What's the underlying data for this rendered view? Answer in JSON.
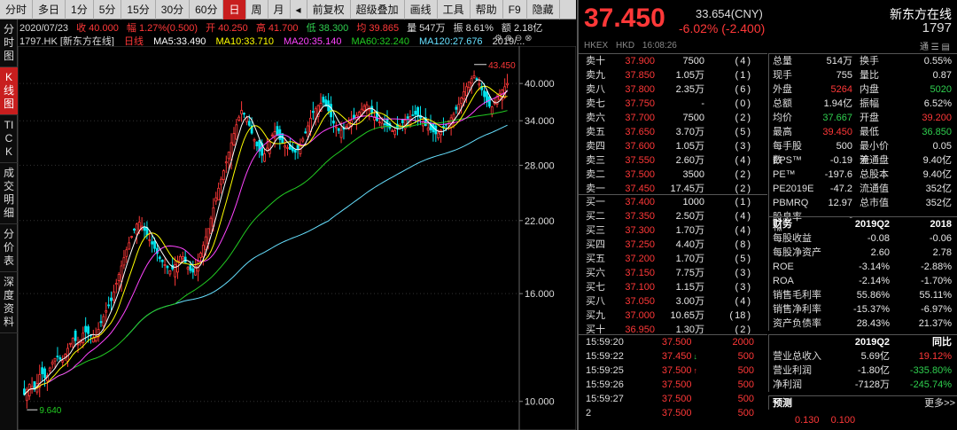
{
  "toolbar": [
    "分时",
    "多日",
    "1分",
    "5分",
    "15分",
    "30分",
    "60分",
    "日",
    "周",
    "月",
    "◂",
    "前复权",
    "超级叠加",
    "画线",
    "工具",
    "帮助",
    "F9",
    "隐藏"
  ],
  "toolbar_active": "日",
  "vtabs": [
    {
      "label": "分时图",
      "active": false
    },
    {
      "label": "K线图",
      "active": true
    },
    {
      "label": "TICK",
      "active": false
    },
    {
      "label": "成交明细",
      "active": false
    },
    {
      "label": "分价表",
      "active": false
    },
    {
      "label": "深度资料",
      "active": false
    }
  ],
  "info1": {
    "date": "2020/07/23",
    "open_close": "收 40.000",
    "amp": "幅 1.27%(0.500)",
    "open": "开 40.250",
    "high": "高 41.700",
    "low": "低 38.300",
    "high2": "均 39.865",
    "vol": "量 547万",
    "swing": "振 8.61%",
    "amount": "额 2.18亿"
  },
  "info2": {
    "code": "1797.HK [新东方在线]",
    "period": "日线",
    "ma5": "MA5:33.490",
    "ma10": "MA10:33.710",
    "ma20": "MA20:35.140",
    "ma60": "MA60:32.240",
    "ma120": "MA120:27.676",
    "date_short": "2019/..."
  },
  "colors": {
    "ma5": "#ffffff",
    "ma10": "#ffff00",
    "ma20": "#ff44ff",
    "ma60": "#22cc22",
    "ma120": "#66e0ff",
    "up": "#ff3838",
    "down": "#00e5ee"
  },
  "chart_data": {
    "type": "candlestick",
    "y_ticks": [
      "40.000",
      "34.000",
      "28.000",
      "22.000",
      "16.000",
      "10.000"
    ],
    "y_log_range": [
      9.0,
      46.0
    ],
    "max_label": "43.450",
    "min_label": "9.640",
    "close_path": [
      10.3,
      10.8,
      10.5,
      11.4,
      11.0,
      11.8,
      12.2,
      11.9,
      12.6,
      13.2,
      12.8,
      13.6,
      13.4,
      13.1,
      14.0,
      14.8,
      15.5,
      16.8,
      18.2,
      19.6,
      20.8,
      22.0,
      21.2,
      20.3,
      19.5,
      18.6,
      18.1,
      17.6,
      18.3,
      19.0,
      18.0,
      17.5,
      18.4,
      19.8,
      21.4,
      23.6,
      25.8,
      27.9,
      30.5,
      33.2,
      35.6,
      34.4,
      32.0,
      30.2,
      29.0,
      30.6,
      32.6,
      31.4,
      30.5,
      30.0,
      29.6,
      30.8,
      32.6,
      35.0,
      36.2,
      37.0,
      35.6,
      33.6,
      32.5,
      32.8,
      33.8,
      34.6,
      35.6,
      36.6,
      35.2,
      34.0,
      33.6,
      33.2,
      32.4,
      33.0,
      34.0,
      34.6,
      35.0,
      34.4,
      33.2,
      32.6,
      32.0,
      32.8,
      33.8,
      34.8,
      36.4,
      38.6,
      40.4,
      41.5,
      39.6,
      37.2,
      35.8,
      37.6,
      38.8,
      40.0
    ]
  },
  "quote": {
    "price": "37.450",
    "ref": "33.654(CNY)",
    "change": "-6.02%  (-2.400)",
    "name": "新东方在线",
    "code": "1797",
    "market": "HKEX",
    "currency": "HKD",
    "time": "16:08:26"
  },
  "asks": [
    {
      "l": "卖十",
      "p": "37.900",
      "v": "7500",
      "n": "4"
    },
    {
      "l": "卖九",
      "p": "37.850",
      "v": "1.05万",
      "n": "1"
    },
    {
      "l": "卖八",
      "p": "37.800",
      "v": "2.35万",
      "n": "6"
    },
    {
      "l": "卖七",
      "p": "37.750",
      "v": "-",
      "n": "0"
    },
    {
      "l": "卖六",
      "p": "37.700",
      "v": "7500",
      "n": "2"
    },
    {
      "l": "卖五",
      "p": "37.650",
      "v": "3.70万",
      "n": "5"
    },
    {
      "l": "卖四",
      "p": "37.600",
      "v": "1.05万",
      "n": "3"
    },
    {
      "l": "卖三",
      "p": "37.550",
      "v": "2.60万",
      "n": "4"
    },
    {
      "l": "卖二",
      "p": "37.500",
      "v": "3500",
      "n": "2"
    },
    {
      "l": "卖一",
      "p": "37.450",
      "v": "17.45万",
      "n": "2"
    }
  ],
  "bids": [
    {
      "l": "买一",
      "p": "37.400",
      "v": "1000",
      "n": "1"
    },
    {
      "l": "买二",
      "p": "37.350",
      "v": "2.50万",
      "n": "4"
    },
    {
      "l": "买三",
      "p": "37.300",
      "v": "1.70万",
      "n": "4"
    },
    {
      "l": "买四",
      "p": "37.250",
      "v": "4.40万",
      "n": "8"
    },
    {
      "l": "买五",
      "p": "37.200",
      "v": "1.70万",
      "n": "5"
    },
    {
      "l": "买六",
      "p": "37.150",
      "v": "7.75万",
      "n": "3"
    },
    {
      "l": "买七",
      "p": "37.100",
      "v": "1.15万",
      "n": "3"
    },
    {
      "l": "买八",
      "p": "37.050",
      "v": "3.00万",
      "n": "4"
    },
    {
      "l": "买九",
      "p": "37.000",
      "v": "10.65万",
      "n": "18"
    },
    {
      "l": "买十",
      "p": "36.950",
      "v": "1.30万",
      "n": "2"
    }
  ],
  "trades": [
    {
      "t": "15:59:20",
      "p": "37.500",
      "v": "2000",
      "arrow": ""
    },
    {
      "t": "15:59:22",
      "p": "37.450",
      "v": "500",
      "arrow": "dn"
    },
    {
      "t": "15:59:25",
      "p": "37.500",
      "v": "500",
      "arrow": "up"
    },
    {
      "t": "15:59:26",
      "p": "37.500",
      "v": "500",
      "arrow": ""
    },
    {
      "t": "15:59:27",
      "p": "37.500",
      "v": "500",
      "arrow": ""
    },
    {
      "t": "2",
      "p": "37.500",
      "v": "500",
      "arrow": ""
    }
  ],
  "stats": [
    {
      "k1": "总量",
      "v1": "514万",
      "k2": "换手",
      "v2": "0.55%",
      "c1": "",
      "c2": ""
    },
    {
      "k1": "现手",
      "v1": "755",
      "k2": "量比",
      "v2": "0.87",
      "c1": "",
      "c2": ""
    },
    {
      "k1": "外盘",
      "v1": "5264",
      "k2": "内盘",
      "v2": "5020",
      "c1": "red",
      "c2": "green"
    },
    {
      "k1": "总额",
      "v1": "1.94亿",
      "k2": "振幅",
      "v2": "6.52%",
      "c1": "",
      "c2": ""
    },
    {
      "k1": "均价",
      "v1": "37.667",
      "k2": "开盘",
      "v2": "39.200",
      "c1": "green",
      "c2": "red"
    },
    {
      "k1": "最高",
      "v1": "39.450",
      "k2": "最低",
      "v2": "36.850",
      "c1": "red",
      "c2": "green"
    },
    {
      "k1": "每手股数",
      "v1": "500",
      "k2": "最小价差",
      "v2": "0.05",
      "c1": "",
      "c2": ""
    },
    {
      "k1": "EPS™",
      "v1": "-0.19",
      "k2": "流通盘",
      "v2": "9.40亿",
      "c1": "",
      "c2": ""
    },
    {
      "k1": "PE™",
      "v1": "-197.6",
      "k2": "总股本",
      "v2": "9.40亿",
      "c1": "",
      "c2": ""
    },
    {
      "k1": "PE2019E",
      "v1": "-47.2",
      "k2": "流通值",
      "v2": "352亿",
      "c1": "",
      "c2": ""
    },
    {
      "k1": "PBMRQ",
      "v1": "12.97",
      "k2": "总市值",
      "v2": "352亿",
      "c1": "",
      "c2": ""
    },
    {
      "k1": "股息率™",
      "v1": "-",
      "k2": "",
      "v2": "",
      "c1": "",
      "c2": ""
    }
  ],
  "fin_head": {
    "k": "财务",
    "a": "2019Q2",
    "b": "2018"
  },
  "fin": [
    {
      "k": "每股收益",
      "a": "-0.08",
      "b": "-0.06"
    },
    {
      "k": "每股净资产",
      "a": "2.60",
      "b": "2.78"
    },
    {
      "k": "ROE",
      "a": "-3.14%",
      "b": "-2.88%"
    },
    {
      "k": "ROA",
      "a": "-2.14%",
      "b": "-1.70%"
    },
    {
      "k": "销售毛利率",
      "a": "55.86%",
      "b": "55.11%"
    },
    {
      "k": "销售净利率",
      "a": "-15.37%",
      "b": "-6.97%"
    },
    {
      "k": "资产负债率",
      "a": "28.43%",
      "b": "21.37%"
    }
  ],
  "growth_head": {
    "k": "",
    "a": "2019Q2",
    "b": "同比"
  },
  "growth": [
    {
      "k": "营业总收入",
      "a": "5.69亿",
      "b": "19.12%",
      "cb": "red"
    },
    {
      "k": "营业利润",
      "a": "-1.80亿",
      "b": "-335.80%",
      "cb": "green"
    },
    {
      "k": "净利润",
      "a": "-7128万",
      "b": "-245.74%",
      "cb": "green"
    }
  ],
  "forecast": {
    "label": "预测",
    "more": "更多>>",
    "v1": "0.130",
    "v2": "0.100"
  }
}
